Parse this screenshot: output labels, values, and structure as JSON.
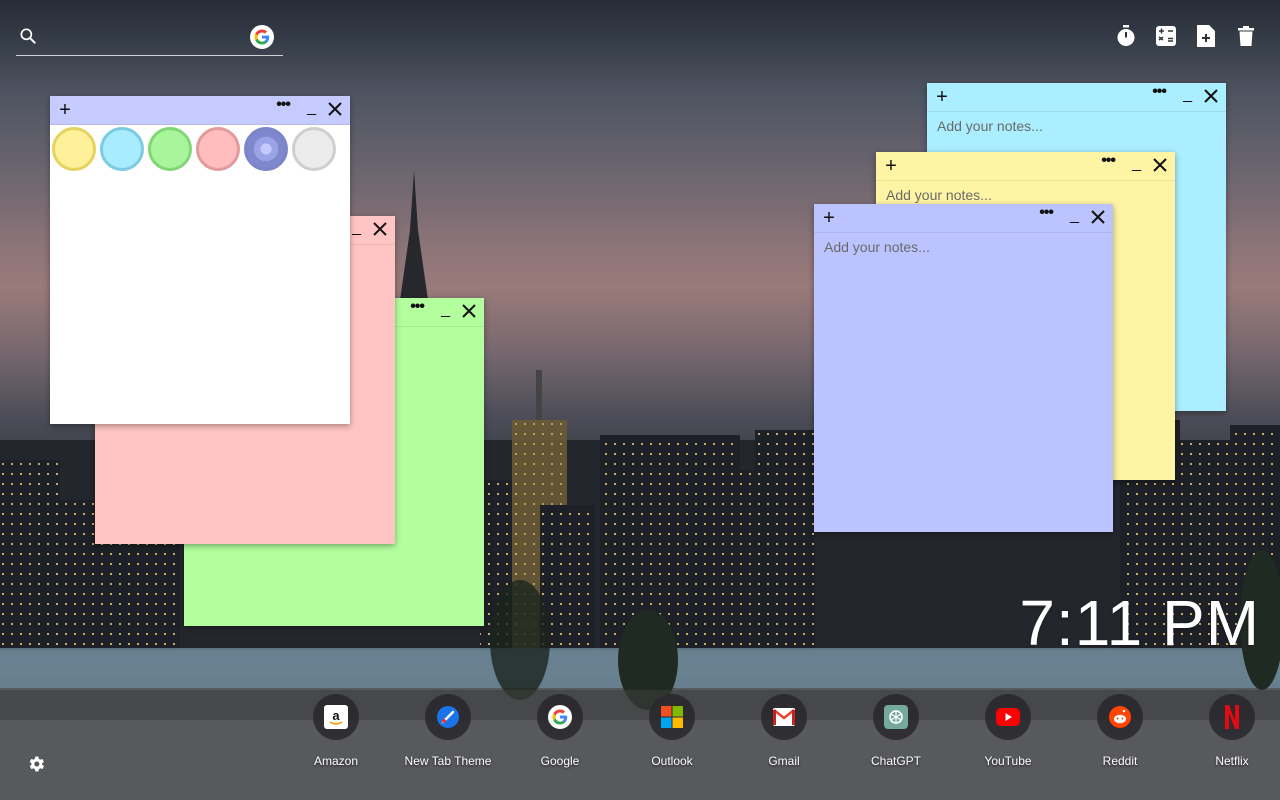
{
  "search": {
    "placeholder": ""
  },
  "top_tools": [
    {
      "name": "timer-icon"
    },
    {
      "name": "calculator-icon"
    },
    {
      "name": "new-note-icon"
    },
    {
      "name": "trash-icon"
    }
  ],
  "notes": {
    "placeholder": "Add your notes...",
    "white": {
      "color": "#ffffff",
      "header": "#c5cbff"
    },
    "pink": {
      "color": "#ffc4c4"
    },
    "green": {
      "color": "#b3ff9e"
    },
    "cyan": {
      "color": "#aaeeff"
    },
    "yellow": {
      "color": "#fff3a4"
    },
    "blue": {
      "color": "#bbc4ff"
    }
  },
  "palette": [
    "#fff19a",
    "#a8ecff",
    "#a9f59c",
    "#ffbdbd",
    "#8c95d6",
    "#ececec"
  ],
  "clock": {
    "time": "7:11 PM"
  },
  "shortcuts": [
    {
      "label": "Amazon",
      "icon": "amazon-icon"
    },
    {
      "label": "New Tab Theme",
      "icon": "new-tab-theme-icon"
    },
    {
      "label": "Google",
      "icon": "google-icon"
    },
    {
      "label": "Outlook",
      "icon": "outlook-icon"
    },
    {
      "label": "Gmail",
      "icon": "gmail-icon"
    },
    {
      "label": "ChatGPT",
      "icon": "chatgpt-icon"
    },
    {
      "label": "YouTube",
      "icon": "youtube-icon"
    },
    {
      "label": "Reddit",
      "icon": "reddit-icon"
    },
    {
      "label": "Netflix",
      "icon": "netflix-icon"
    }
  ]
}
